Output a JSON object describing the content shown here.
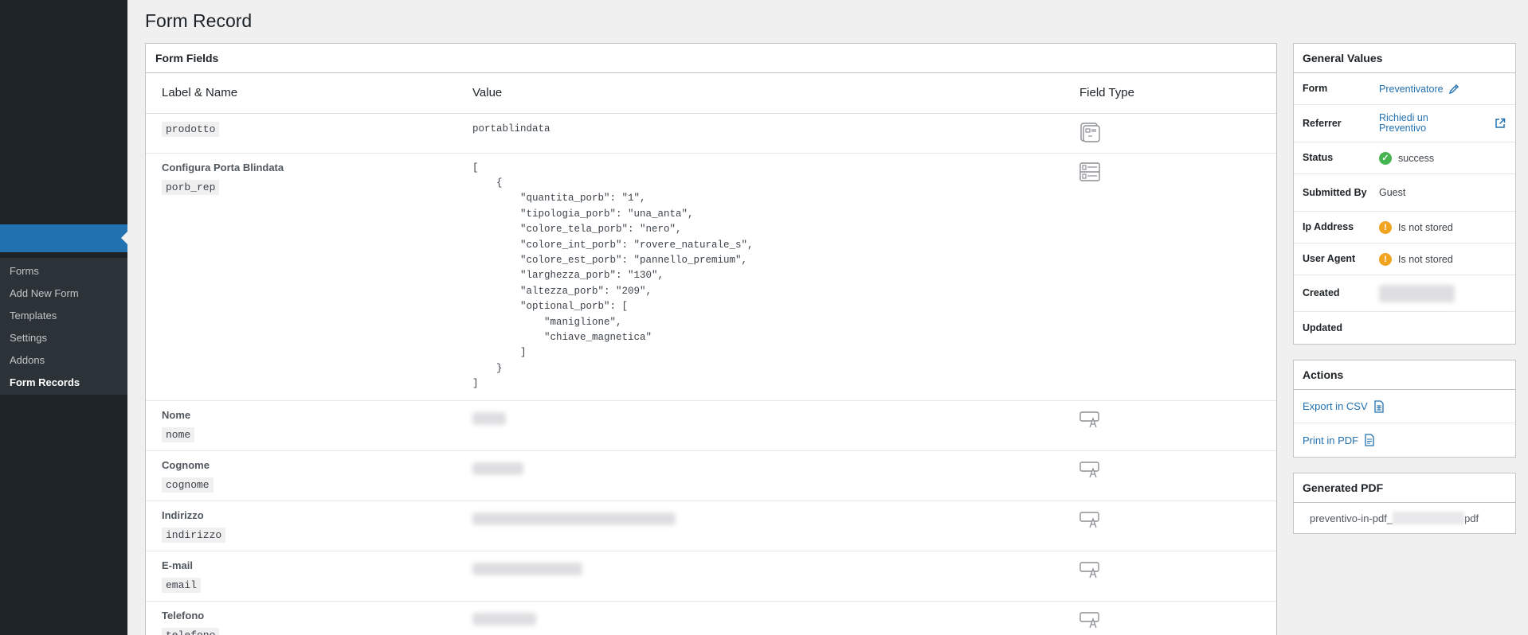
{
  "sidebar": {
    "items": [
      {
        "label": "Forms"
      },
      {
        "label": "Add New Form"
      },
      {
        "label": "Templates"
      },
      {
        "label": "Settings"
      },
      {
        "label": "Addons"
      },
      {
        "label": "Form Records"
      }
    ]
  },
  "page": {
    "title": "Form Record"
  },
  "form_fields": {
    "title": "Form Fields",
    "columns": {
      "label_name": "Label & Name",
      "value": "Value",
      "field_type": "Field Type"
    },
    "rows": [
      {
        "label": "",
        "name": "prodotto",
        "value": "portablindata",
        "type_icon": "product-icon"
      },
      {
        "label": "Configura Porta Blindata",
        "name": "porb_rep",
        "value": "[\n    {\n        \"quantita_porb\": \"1\",\n        \"tipologia_porb\": \"una_anta\",\n        \"colore_tela_porb\": \"nero\",\n        \"colore_int_porb\": \"rovere_naturale_s\",\n        \"colore_est_porb\": \"pannello_premium\",\n        \"larghezza_porb\": \"130\",\n        \"altezza_porb\": \"209\",\n        \"optional_porb\": [\n            \"maniglione\",\n            \"chiave_magnetica\"\n        ]\n    }\n]",
        "type_icon": "repeater-icon"
      },
      {
        "label": "Nome",
        "name": "nome",
        "value": "",
        "type_icon": "text-field-icon"
      },
      {
        "label": "Cognome",
        "name": "cognome",
        "value": "",
        "type_icon": "text-field-icon"
      },
      {
        "label": "Indirizzo",
        "name": "indirizzo",
        "value": "",
        "type_icon": "text-field-icon"
      },
      {
        "label": "E-mail",
        "name": "email",
        "value": "",
        "type_icon": "text-field-icon"
      },
      {
        "label": "Telefono",
        "name": "telefono",
        "value": "",
        "type_icon": "text-field-icon"
      }
    ]
  },
  "general_values": {
    "title": "General Values",
    "form": {
      "key": "Form",
      "value": "Preventivatore"
    },
    "referrer": {
      "key": "Referrer",
      "value": "Richiedi un Preventivo"
    },
    "status": {
      "key": "Status",
      "value": "success"
    },
    "submitted_by": {
      "key": "Submitted By",
      "value": "Guest"
    },
    "ip_address": {
      "key": "Ip Address",
      "value": "Is not stored"
    },
    "user_agent": {
      "key": "User Agent",
      "value": "Is not stored"
    },
    "created": {
      "key": "Created",
      "value": ""
    },
    "updated": {
      "key": "Updated",
      "value": ""
    }
  },
  "actions": {
    "title": "Actions",
    "export_csv": "Export in CSV",
    "print_pdf": "Print in PDF"
  },
  "generated_pdf": {
    "title": "Generated PDF",
    "file_prefix": "preventivo-in-pdf_",
    "file_suffix": "pdf"
  },
  "colors": {
    "sidebar_bg": "#1d2327",
    "accent": "#2271b1",
    "success": "#46b450",
    "warning": "#f0a420"
  }
}
